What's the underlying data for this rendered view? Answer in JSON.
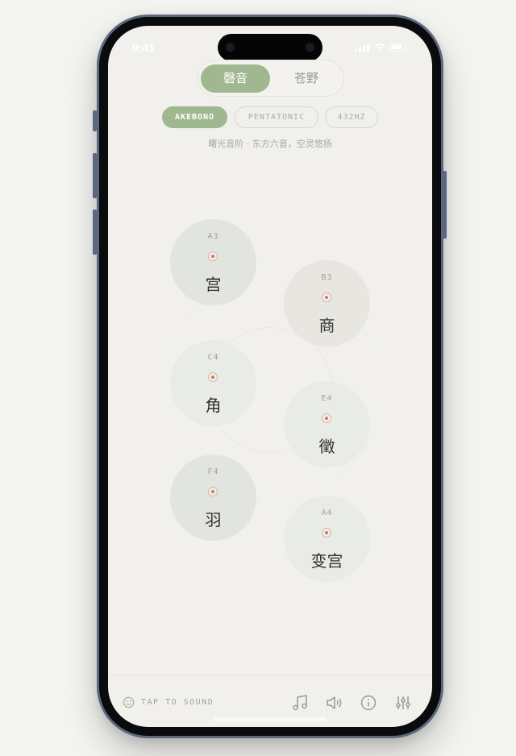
{
  "status_bar": {
    "time": "9:41",
    "icons": [
      "cellular-signal-icon",
      "wifi-icon",
      "battery-icon"
    ]
  },
  "mode_toggle": {
    "options": [
      {
        "label": "磬音",
        "selected": true
      },
      {
        "label": "苍野",
        "selected": false
      }
    ]
  },
  "scales": {
    "chips": [
      {
        "label": "AKEBONO",
        "selected": true
      },
      {
        "label": "PENTATONIC",
        "selected": false
      },
      {
        "label": "432HZ",
        "selected": false
      }
    ],
    "description": "曙光音阶 · 东方六音，空灵悠扬"
  },
  "pads": [
    {
      "note": "A3",
      "name": "宫"
    },
    {
      "note": "B3",
      "name": "商"
    },
    {
      "note": "C4",
      "name": "角"
    },
    {
      "note": "E4",
      "name": "徵"
    },
    {
      "note": "F4",
      "name": "羽"
    },
    {
      "note": "A4",
      "name": "变宫"
    }
  ],
  "bottom_bar": {
    "hint": "TAP TO SOUND",
    "hint_icon": "smiley-icon",
    "tools": [
      "music-note-icon",
      "speaker-icon",
      "info-icon",
      "sliders-icon"
    ]
  },
  "colors": {
    "accent": "#9fb88f",
    "indicator": "#c87a68",
    "background": "#f1f0ec",
    "frame": "#5d6780"
  }
}
